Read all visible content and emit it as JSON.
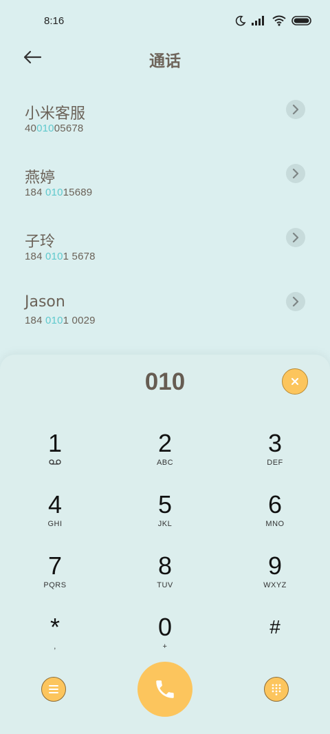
{
  "status_bar": {
    "time": "8:16"
  },
  "header": {
    "title": "通话"
  },
  "contacts": [
    {
      "name": "小米客服",
      "number_pre": "40",
      "number_match": "010",
      "number_post": "05678"
    },
    {
      "name": "燕婷",
      "number_pre": "184 ",
      "number_match": "010",
      "number_post": "15689"
    },
    {
      "name": "子玲",
      "number_pre": "184 ",
      "number_match": "010",
      "number_post": "1 5678"
    },
    {
      "name": "Jason",
      "number_pre": "184 ",
      "number_match": "010",
      "number_post": "1 0029"
    }
  ],
  "dialer": {
    "input": "010",
    "keys": [
      {
        "digit": "1",
        "letters": ""
      },
      {
        "digit": "2",
        "letters": "ABC"
      },
      {
        "digit": "3",
        "letters": "DEF"
      },
      {
        "digit": "4",
        "letters": "GHI"
      },
      {
        "digit": "5",
        "letters": "JKL"
      },
      {
        "digit": "6",
        "letters": "MNO"
      },
      {
        "digit": "7",
        "letters": "PQRS"
      },
      {
        "digit": "8",
        "letters": "TUV"
      },
      {
        "digit": "9",
        "letters": "WXYZ"
      },
      {
        "digit": "*",
        "letters": ","
      },
      {
        "digit": "0",
        "letters": "+"
      },
      {
        "digit": "#",
        "letters": ""
      }
    ]
  },
  "icons": {
    "back": "arrow-left-icon",
    "chevron": "chevron-right-icon",
    "clear": "close-icon",
    "voicemail": "voicemail-icon",
    "menu": "menu-icon",
    "call": "phone-icon",
    "keypad": "dialpad-icon"
  },
  "colors": {
    "background": "#dbefef",
    "accent": "#fcc55d",
    "match_highlight": "#5fc9cd",
    "text": "#6b6258"
  }
}
